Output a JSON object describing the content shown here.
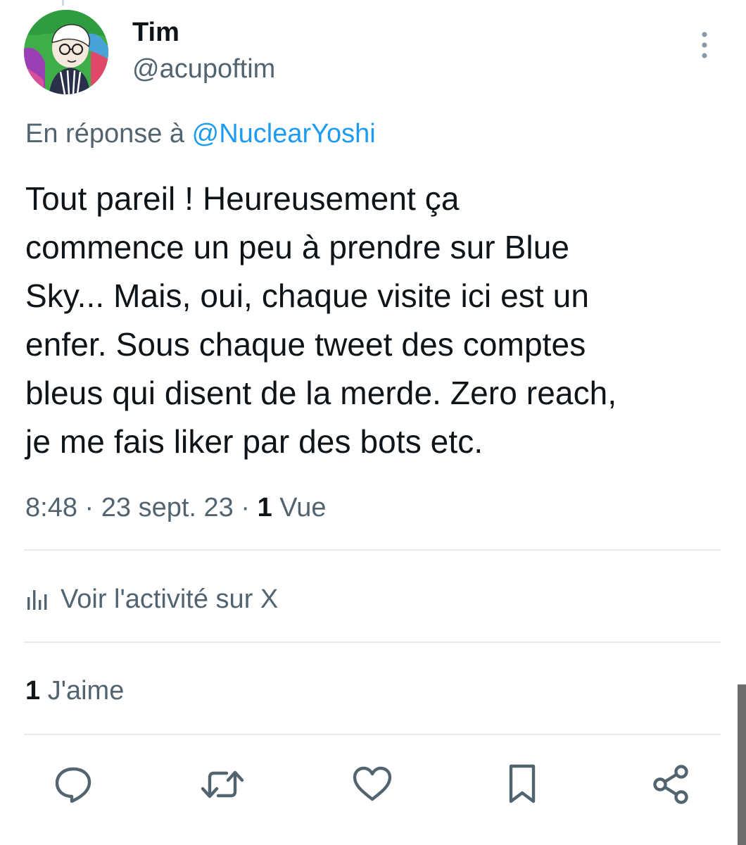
{
  "author": {
    "name": "Tim",
    "handle": "@acupoftim",
    "avatar_icon": "user-avatar"
  },
  "reply": {
    "prefix": "En réponse à",
    "mention": "@NuclearYoshi"
  },
  "tweet": {
    "text": "Tout pareil ! Heureusement ça\ncommence un peu à prendre sur Blue\nSky... Mais, oui, chaque visite ici est un\nenfer. Sous chaque tweet des comptes\nbleus qui disent de la merde. Zero reach,\nje me fais liker par des bots etc."
  },
  "meta": {
    "time": "8:48",
    "date": "23 sept. 23",
    "views_count": "1",
    "views_label": "Vue"
  },
  "activity": {
    "icon": "analytics-icon",
    "label": "Voir l'activité sur X"
  },
  "likes": {
    "count": "1",
    "label": "J'aime"
  },
  "actions": {
    "reply_icon": "reply-icon",
    "retweet_icon": "retweet-icon",
    "like_icon": "heart-icon",
    "bookmark_icon": "bookmark-icon",
    "share_icon": "share-icon"
  },
  "colors": {
    "text_primary": "#0f1419",
    "text_secondary": "#536471",
    "link": "#1d9bf0",
    "divider": "#e7eaec"
  }
}
